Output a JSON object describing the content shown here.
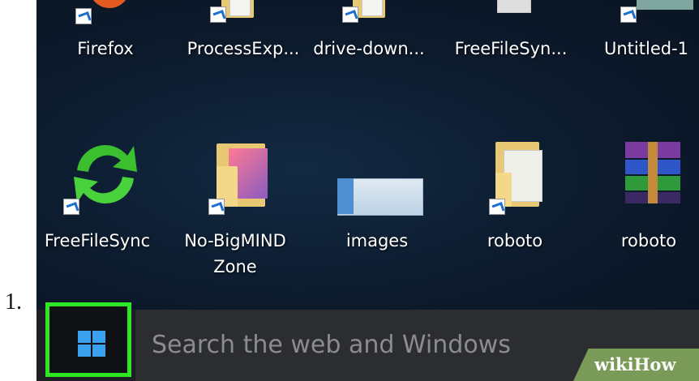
{
  "step_number": "1.",
  "desktop": {
    "row1": [
      {
        "label": "Firefox",
        "icon": "firefox-icon"
      },
      {
        "label": "ProcessExp...",
        "icon": "folder-icon"
      },
      {
        "label": "drive-down...",
        "icon": "folder-icon"
      },
      {
        "label": "FreeFileSyn...",
        "icon": "folder-icon"
      },
      {
        "label": "Untitled-1",
        "icon": "image-file-icon"
      }
    ],
    "row2": [
      {
        "label": "FreeFileSync",
        "icon": "freefilesync-icon"
      },
      {
        "label_line1": "No-BigMIND",
        "label_line2": "Zone",
        "icon": "folder-icon"
      },
      {
        "label": "images",
        "icon": "image-file-icon"
      },
      {
        "label": "roboto",
        "icon": "folder-icon"
      },
      {
        "label": "roboto",
        "icon": "winrar-archive-icon"
      }
    ]
  },
  "taskbar": {
    "start_icon": "windows-logo-icon",
    "search_placeholder": "Search the web and Windows"
  },
  "watermark": {
    "part1": "wiki",
    "part2": "How"
  },
  "colors": {
    "highlight": "#2ee826",
    "taskbar": "#1c1e23",
    "search_box": "#2c2d30",
    "windows_logo": "#3aa1ee",
    "desktop": "#0f1b2b"
  }
}
